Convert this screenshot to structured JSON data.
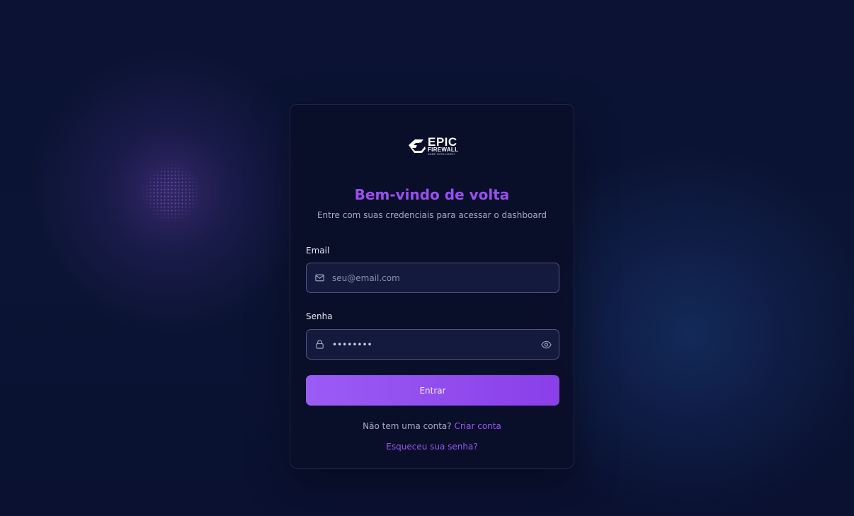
{
  "brand": {
    "logo_word": "EPIC",
    "logo_sub": "FIREWALL",
    "logo_tagline": "GAME INTELLIGENT"
  },
  "login": {
    "title": "Bem-vindo de volta",
    "subtitle": "Entre com suas credenciais para acessar o dashboard",
    "email_label": "Email",
    "email_placeholder": "seu@email.com",
    "password_label": "Senha",
    "password_value": "••••••••",
    "submit_label": "Entrar",
    "no_account_text": "Não tem uma conta?",
    "create_account_link": "Criar conta",
    "forgot_password_link": "Esqueceu sua senha?"
  },
  "icons": {
    "email": "mail-icon",
    "password": "lock-icon",
    "toggle_visibility": "eye-icon",
    "logo": "epic-firewall-logo"
  },
  "colors": {
    "accent": "#9b4ff0",
    "button_gradient_start": "#9a5cf5",
    "button_gradient_end": "#8a3fe8",
    "background": "#0b1230",
    "card": "#0a0e28"
  }
}
